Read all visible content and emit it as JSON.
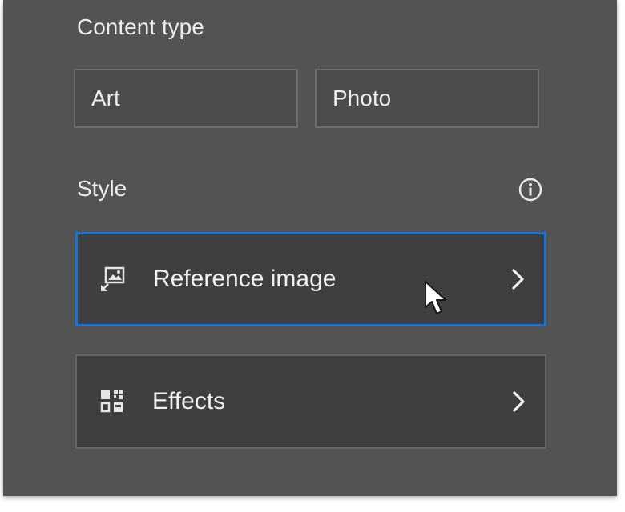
{
  "content_type": {
    "label": "Content type",
    "options": [
      "Art",
      "Photo"
    ]
  },
  "style": {
    "label": "Style",
    "info_icon": "info-icon",
    "items": [
      {
        "label": "Reference image",
        "icon": "reference-image-icon",
        "selected": true
      },
      {
        "label": "Effects",
        "icon": "effects-icon",
        "selected": false
      }
    ]
  },
  "colors": {
    "panel_background": "#535353",
    "selection_border": "#1a73d9"
  }
}
